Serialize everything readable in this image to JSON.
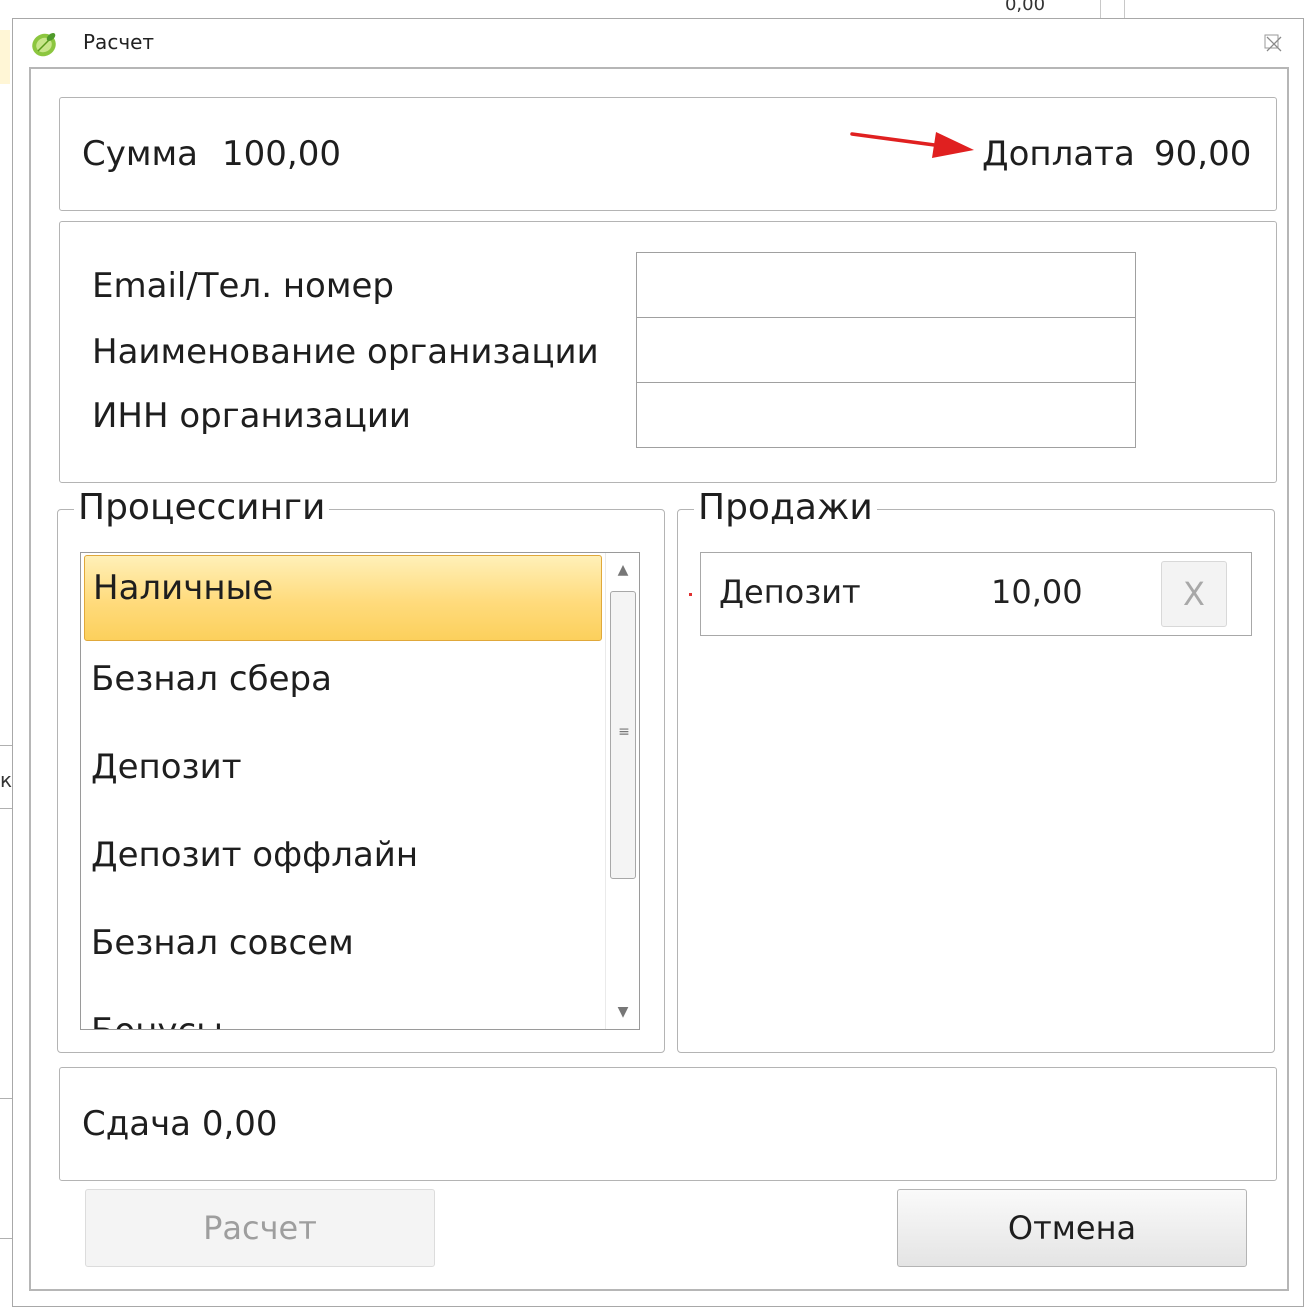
{
  "background": {
    "top_cell_text": "0,00",
    "left_fragment_text": "к"
  },
  "window": {
    "title": "Расчет",
    "icon": "lime-icon",
    "close_icon": "close-icon"
  },
  "summary": {
    "sum_label": "Сумма",
    "sum_value": "100,00",
    "doplata_label": "Доплата",
    "doplata_value": "90,00",
    "arrow_color": "#e02020"
  },
  "contact": {
    "fields": [
      {
        "label": "Email/Тел. номер",
        "value": ""
      },
      {
        "label": "Наименование организации",
        "value": ""
      },
      {
        "label": "ИНН организации",
        "value": ""
      }
    ]
  },
  "processing": {
    "title": "Процессинги",
    "items": [
      "Наличные",
      "Безнал сбера",
      "Депозит",
      "Депозит оффлайн",
      "Безнал совсем",
      "Бонусы"
    ],
    "selected_index": 0,
    "selected_color": "#ffd766"
  },
  "sales": {
    "title": "Продажи",
    "rows": [
      {
        "name": "Депозит",
        "amount": "10,00",
        "remove_label": "X"
      }
    ]
  },
  "change": {
    "label": "Сдача 0,00"
  },
  "buttons": {
    "calculate_label": "Расчет",
    "cancel_label": "Отмена"
  }
}
